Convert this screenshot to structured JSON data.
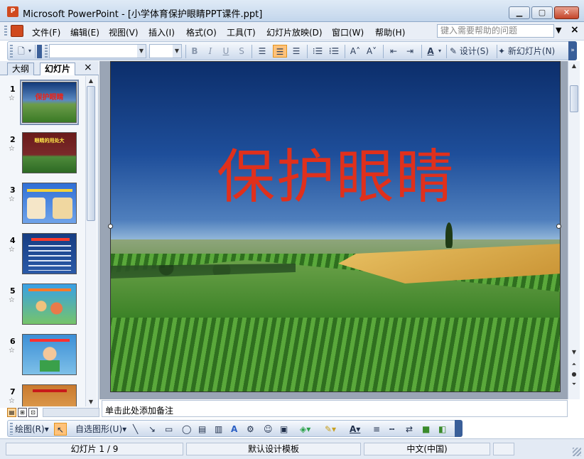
{
  "window": {
    "title": "Microsoft PowerPoint - [小学体育保护眼睛PPT课件.ppt]",
    "app_icon_label": "P"
  },
  "menu": {
    "items": [
      "文件(F)",
      "编辑(E)",
      "视图(V)",
      "插入(I)",
      "格式(O)",
      "工具(T)",
      "幻灯片放映(D)",
      "窗口(W)",
      "帮助(H)"
    ],
    "help_placeholder": "键入需要帮助的问题"
  },
  "toolbar": {
    "bold": "B",
    "italic": "I",
    "underline": "U",
    "shadow": "S",
    "font_color": "A",
    "design_label": "设计(S)",
    "new_slide_label": "新幻灯片(N)"
  },
  "left_panel": {
    "tabs": [
      "大纲",
      "幻灯片"
    ],
    "active_tab": "幻灯片",
    "close": "×",
    "thumbnails": [
      {
        "num": "1",
        "title": "保护眼睛",
        "selected": true
      },
      {
        "num": "2",
        "title": "眼睛的用处大",
        "selected": false
      },
      {
        "num": "3",
        "title": "",
        "selected": false
      },
      {
        "num": "4",
        "title": "",
        "selected": false
      },
      {
        "num": "5",
        "title": "",
        "selected": false
      },
      {
        "num": "6",
        "title": "",
        "selected": false
      },
      {
        "num": "7",
        "title": "",
        "selected": false
      }
    ]
  },
  "slide": {
    "title": "保护眼睛"
  },
  "notes": {
    "placeholder": "单击此处添加备注"
  },
  "drawing_toolbar": {
    "draw_label": "绘图(R)",
    "autoshapes_label": "自选图形(U)"
  },
  "status": {
    "slide_position": "幻灯片 1 / 9",
    "template": "默认设计模板",
    "language": "中文(中国)"
  },
  "colors": {
    "title_red": "#e0301c",
    "accent_orange": "#ffc27a"
  }
}
